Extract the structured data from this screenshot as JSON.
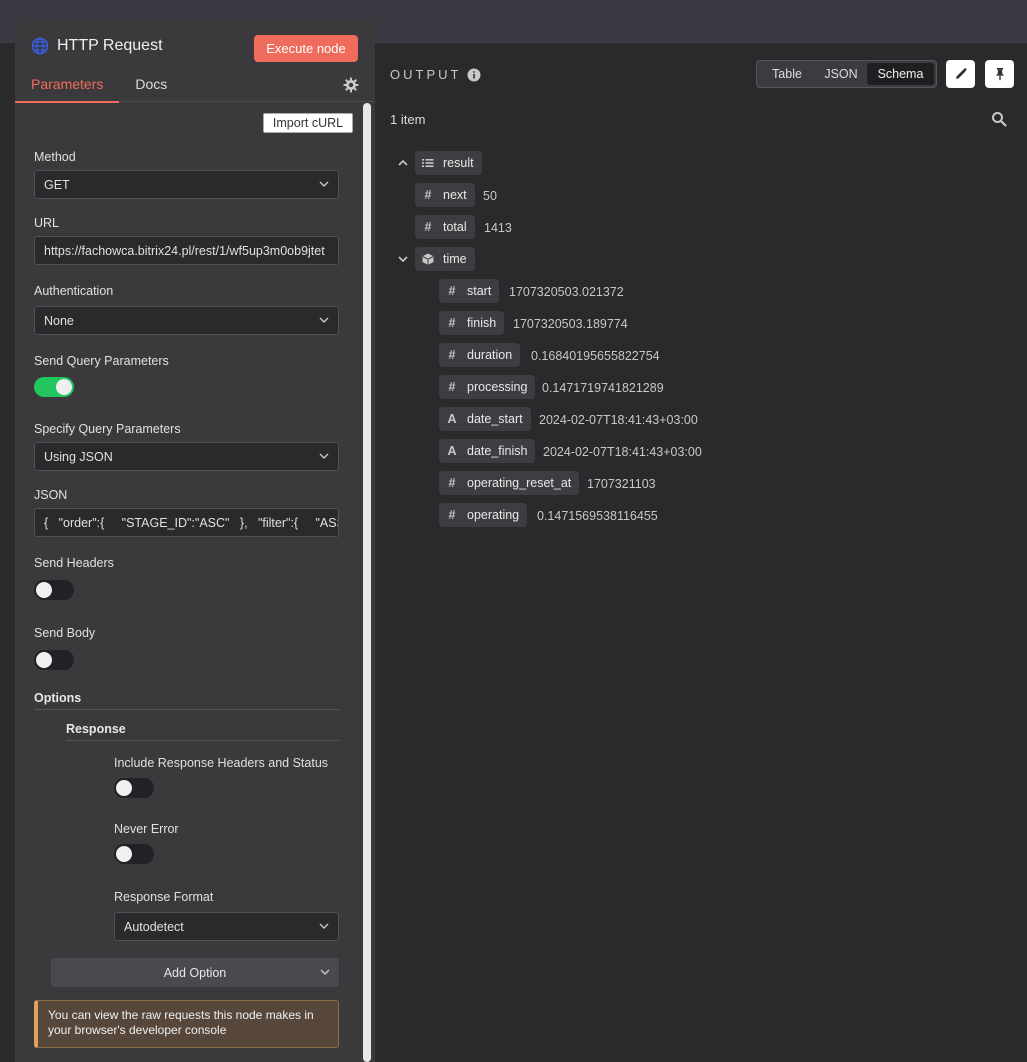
{
  "node": {
    "title": "HTTP Request",
    "execute_label": "Execute node",
    "tabs": [
      "Parameters",
      "Docs"
    ]
  },
  "params": {
    "import_label": "Import cURL",
    "method_label": "Method",
    "method_value": "GET",
    "url_label": "URL",
    "url_value": "https://fachowca.bitrix24.pl/rest/1/wf5up3m0ob9jtet",
    "auth_label": "Authentication",
    "auth_value": "None",
    "send_query_label": "Send Query Parameters",
    "send_query_on": true,
    "specify_query_label": "Specify Query Parameters",
    "specify_query_value": "Using JSON",
    "json_label": "JSON",
    "json_value": "{   \"order\":{     \"STAGE_ID\":\"ASC\"   },   \"filter\":{     \"ASSI",
    "send_headers_label": "Send Headers",
    "send_headers_on": false,
    "send_body_label": "Send Body",
    "send_body_on": false,
    "options_label": "Options",
    "response_label": "Response",
    "include_headers_label": "Include Response Headers and Status",
    "include_headers_on": false,
    "never_error_label": "Never Error",
    "never_error_on": false,
    "response_format_label": "Response Format",
    "response_format_value": "Autodetect",
    "add_option_label": "Add Option",
    "notice_text": "You can view the raw requests this node makes in your browser's developer console"
  },
  "output": {
    "title": "OUTPUT",
    "views": [
      "Table",
      "JSON",
      "Schema"
    ],
    "active_view": "Schema",
    "items_count": "1 item",
    "tree": {
      "result": {
        "key": "result",
        "children": [
          {
            "type": "#",
            "key": "next",
            "value": "50"
          },
          {
            "type": "#",
            "key": "total",
            "value": "1413"
          }
        ]
      },
      "time": {
        "key": "time",
        "children": [
          {
            "type": "#",
            "key": "start",
            "value": "1707320503.021372"
          },
          {
            "type": "#",
            "key": "finish",
            "value": "1707320503.189774"
          },
          {
            "type": "#",
            "key": "duration",
            "value": "0.16840195655822754"
          },
          {
            "type": "#",
            "key": "processing",
            "value": "0.1471719741821289"
          },
          {
            "type": "A",
            "key": "date_start",
            "value": "2024-02-07T18:41:43+03:00"
          },
          {
            "type": "A",
            "key": "date_finish",
            "value": "2024-02-07T18:41:43+03:00"
          },
          {
            "type": "#",
            "key": "operating_reset_at",
            "value": "1707321103"
          },
          {
            "type": "#",
            "key": "operating",
            "value": "0.1471569538116455"
          }
        ]
      }
    }
  },
  "colors": {
    "accent": "#ef6b5b",
    "toggle_on": "#22c55e",
    "globe": "#3b5bdb"
  }
}
